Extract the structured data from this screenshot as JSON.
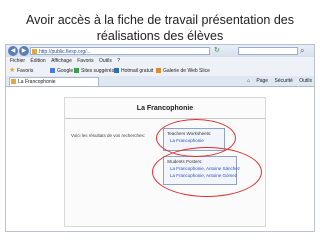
{
  "slide": {
    "title_line1": "Avoir accès à la fiche de travail présentation des",
    "title_line2": "réalisations des élèves"
  },
  "browser": {
    "address": "http://public.fiesp.org/...",
    "menu": [
      "Fichier",
      "Édition",
      "Affichage",
      "Favoris",
      "Outils",
      "?"
    ],
    "favorites_label": "Favoris",
    "favorites_links": [
      {
        "label": "Google",
        "color": "#4a7bd8"
      },
      {
        "label": "Sites suggérés",
        "color": "#3aa04a"
      },
      {
        "label": "Hotmail gratuit",
        "color": "#2f6fb5"
      },
      {
        "label": "Galerie de Web Slice",
        "color": "#e08a2a"
      }
    ],
    "tab_label": "La Francophonie",
    "toolbar_right": [
      "Page",
      "Sécurité",
      "Outils"
    ]
  },
  "page": {
    "heading": "La Francophonie",
    "results_text": "Voici les résultats de vos recherches:",
    "teachers": {
      "title": "Teachers Worksheets:",
      "links": [
        "La Francophonie"
      ]
    },
    "students": {
      "title": "Students Posters:",
      "links": [
        "La Francophonie, Antoine Sánchez",
        "La Francophonie, Antoine Gómez"
      ]
    }
  },
  "colors": {
    "annotation": "#e23030",
    "link": "#2b4fb5"
  }
}
